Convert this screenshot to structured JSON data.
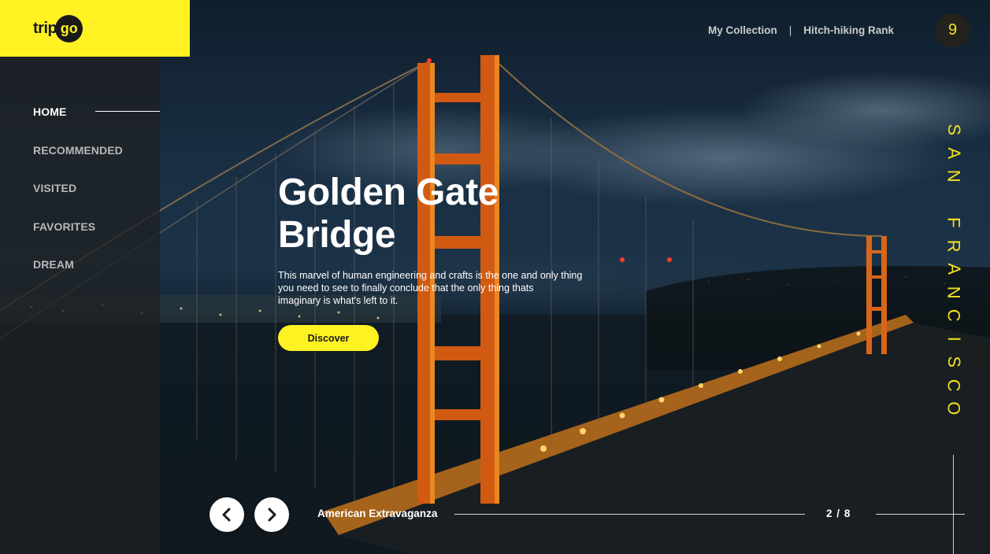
{
  "brand": {
    "logo_trip": "trip",
    "logo_go": "go"
  },
  "sidebar": {
    "items": [
      {
        "label": "HOME",
        "active": true
      },
      {
        "label": "RECOMMENDED",
        "active": false
      },
      {
        "label": "VISITED",
        "active": false
      },
      {
        "label": "FAVORITES",
        "active": false
      },
      {
        "label": "DREAM",
        "active": false
      }
    ]
  },
  "topnav": {
    "link1": "My Collection",
    "separator": "|",
    "link2": "Hitch-hiking Rank",
    "badge_count": "9"
  },
  "hero": {
    "title_line1": "Golden Gate",
    "title_line2": "Bridge",
    "description_line1": "This marvel of human engineering and crafts is the one and only thing",
    "description_line2": "you need to see to finally conclude that the only thing thats",
    "description_line3": "imaginary is what's left to it.",
    "cta_label": "Discover",
    "city_letters": [
      "S",
      "A",
      "N",
      " ",
      "F",
      "R",
      "A",
      "N",
      "C",
      "I",
      "S",
      "C",
      "O"
    ]
  },
  "footer": {
    "collection_name": "American Extravaganza",
    "current": "2",
    "separator": "/",
    "total": "8"
  },
  "colors": {
    "accent": "#fff122",
    "dark": "#1f2124",
    "text": "#ffffff"
  },
  "icons": {
    "prev": "chevron-left-icon",
    "next": "chevron-right-icon"
  }
}
